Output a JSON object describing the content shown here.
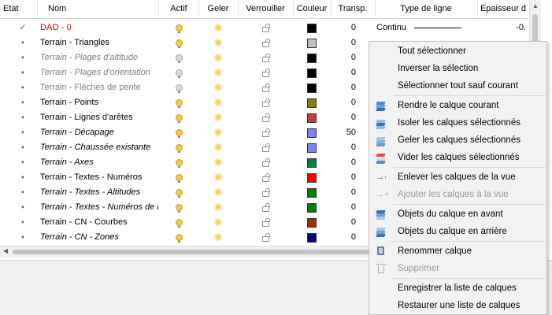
{
  "columns": {
    "etat": "Etat",
    "nom": "Nom",
    "actif": "Actif",
    "geler": "Geler",
    "verrouiller": "Verrouiller",
    "couleur": "Couleur",
    "transp": "Transp.",
    "type_ligne": "Type de ligne",
    "epaisseur": "Epaisseur d"
  },
  "rows": [
    {
      "nom": "DAO - 0",
      "style": "red",
      "actif": "on",
      "color": "#000000",
      "transp": "0",
      "ltype": "Continu",
      "lw": "-0."
    },
    {
      "nom": "Terrain - Triangles",
      "style": "normal",
      "actif": "on",
      "color": "#c0c0c0",
      "transp": "0"
    },
    {
      "nom": "Terrain - Plages d'altitude",
      "style": "italic-gray",
      "actif": "off",
      "color": "#000000",
      "transp": "0"
    },
    {
      "nom": "Terrain - Plages d'orientation",
      "style": "italic-gray",
      "actif": "off",
      "color": "#000000",
      "transp": "0"
    },
    {
      "nom": "Terrain - Flèches de pente",
      "style": "gray",
      "actif": "off",
      "color": "#000000",
      "transp": "0"
    },
    {
      "nom": "Terrain - Points",
      "style": "normal",
      "actif": "on",
      "color": "#808000",
      "transp": "0"
    },
    {
      "nom": "Terrain - Lignes d'arêtes",
      "style": "normal",
      "actif": "on",
      "color": "#c04040",
      "transp": "0"
    },
    {
      "nom": "Terrain - Décapage",
      "style": "italic",
      "actif": "on",
      "color": "#8080ff",
      "transp": "50"
    },
    {
      "nom": "Terrain - Chaussée existante",
      "style": "italic",
      "actif": "on",
      "color": "#8080ff",
      "transp": "0"
    },
    {
      "nom": "Terrain - Axes",
      "style": "italic",
      "actif": "on",
      "color": "#008040",
      "transp": "0"
    },
    {
      "nom": "Terrain - Textes - Numéros",
      "style": "normal",
      "actif": "on",
      "color": "#ff0000",
      "transp": "0"
    },
    {
      "nom": "Terrain - Textes - Altitudes",
      "style": "italic",
      "actif": "on",
      "color": "#008000",
      "transp": "0"
    },
    {
      "nom": "Terrain - Textes - Numéros de l",
      "style": "italic",
      "actif": "on",
      "color": "#008000",
      "transp": "0"
    },
    {
      "nom": "Terrain - CN - Courbes",
      "style": "normal",
      "actif": "on",
      "color": "#a03000",
      "transp": "0"
    },
    {
      "nom": "Terrain - CN - Zones",
      "style": "italic",
      "actif": "on",
      "color": "#000080",
      "transp": "0"
    }
  ],
  "menu": {
    "select_all": "Tout sélectionner",
    "invert_selection": "Inverser la sélection",
    "select_all_but_current": "Sélectionner tout sauf courant",
    "make_current": "Rendre le calque courant",
    "isolate": "Isoler les calques sélectionnés",
    "freeze": "Geler les calques sélectionnés",
    "empty": "Vider les calques sélectionnés",
    "remove_from_view": "Enlever les calques de la vue",
    "add_to_view": "Ajouter les calques à la vue",
    "bring_forward": "Objets du calque en avant",
    "send_backward": "Objets du calque en arrière",
    "rename": "Renommer calque",
    "delete": "Supprimer",
    "save_list": "Enregistrer la liste de calques",
    "restore_list": "Restaurer une liste de calques"
  },
  "icons": {
    "make_current": "layers-current-icon",
    "isolate": "layers-isolate-icon",
    "freeze": "layers-freeze-icon",
    "empty": "layers-empty-icon",
    "remove_from_view": "remove-from-view-icon",
    "add_to_view": "add-to-view-icon",
    "bring_forward": "layers-forward-icon",
    "send_backward": "layers-backward-icon",
    "rename": "rename-icon",
    "delete": "trash-icon"
  }
}
